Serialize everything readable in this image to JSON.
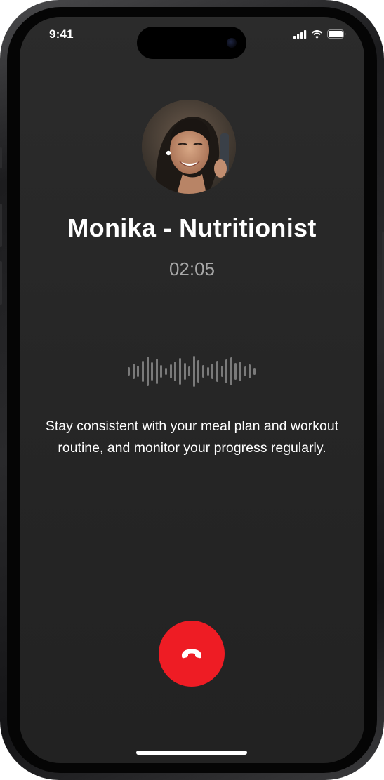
{
  "status_bar": {
    "time": "9:41",
    "signal_icon": "cellular-signal-icon",
    "wifi_icon": "wifi-icon",
    "battery_icon": "battery-icon"
  },
  "call": {
    "avatar_icon": "caller-avatar",
    "caller_name": "Monika - Nutritionist",
    "duration": "02:05",
    "waveform_icon": "audio-waveform-icon",
    "transcript": "Stay consistent with your meal plan and workout routine, and monitor your progress regularly.",
    "end_call_icon": "phone-hangup-icon"
  },
  "colors": {
    "end_call": "#ee1c24",
    "background": "#262626",
    "secondary_text": "#a8a8a8"
  }
}
